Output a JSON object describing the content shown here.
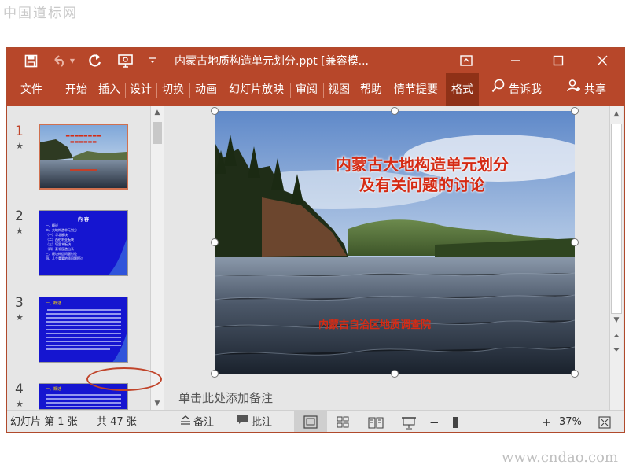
{
  "watermark": {
    "top": "中国道标网",
    "bottom": "www.cndao.com"
  },
  "window": {
    "title": "内蒙古地质构造单元划分.ppt [兼容模..."
  },
  "ribbon": {
    "tabs": [
      "文件",
      "开始",
      "插入",
      "设计",
      "切换",
      "动画",
      "幻灯片放映",
      "审阅",
      "视图",
      "帮助",
      "情节提要",
      "格式"
    ],
    "active_tab": "格式",
    "tell_me": "告诉我",
    "share": "共享"
  },
  "thumbnails": [
    {
      "number": "1",
      "star": "★",
      "selected": true
    },
    {
      "number": "2",
      "star": "★",
      "title": "内 容",
      "lines": [
        "一、概述",
        "二、大地构造单元划分",
        "（一）华北板块",
        "（二）西伯利亚板块",
        "（三）塔里木板块",
        "（四）秦祁昆造山系",
        "三、板块构造问题讨论",
        "四、几个重要地质问题探讨"
      ]
    },
    {
      "number": "3",
      "star": "★",
      "title": "一、概述"
    },
    {
      "number": "4",
      "star": "★",
      "title": "一、概述"
    }
  ],
  "slide": {
    "title_line1": "内蒙古大地构造单元划分",
    "title_line2": "及有关问题的讨论",
    "subtitle": "内蒙古自治区地质调查院",
    "title_color": "#d52b14"
  },
  "notes": {
    "placeholder": "单击此处添加备注"
  },
  "status": {
    "slide_index": "幻灯片 第 1 张",
    "slide_total": "共 47 张",
    "notes_button": "备注",
    "comments_button": "批注",
    "zoom": "37%",
    "zoom_minus": "−",
    "zoom_plus": "+"
  },
  "colors": {
    "accent": "#b7472a",
    "highlight_circle": "#c0442a",
    "thumb_blue": "#1515d0"
  }
}
